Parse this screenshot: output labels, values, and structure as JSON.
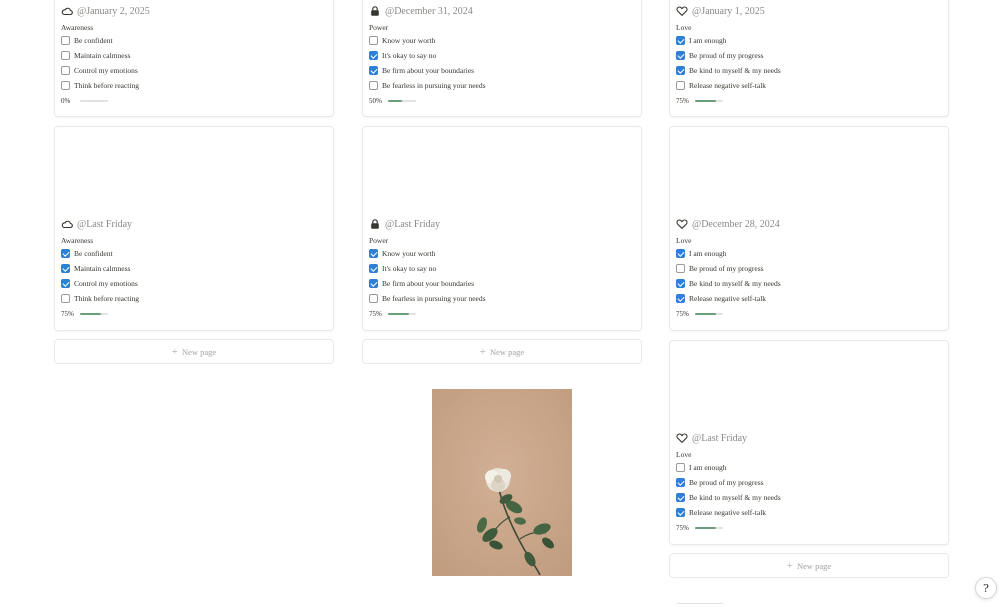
{
  "board": {
    "cards": [
      {
        "icon": "cloud-icon",
        "date": "@January 2, 2025",
        "category": "Awareness",
        "progress_label": "0%",
        "progress": 0.0,
        "tasks": [
          {
            "label": "Be confident",
            "checked": false
          },
          {
            "label": "Maintain calmness",
            "checked": false
          },
          {
            "label": "Control my emotions",
            "checked": false
          },
          {
            "label": "Think before reacting",
            "checked": false
          }
        ]
      },
      {
        "icon": "lock-icon",
        "date": "@December 31, 2024",
        "category": "Power",
        "progress_label": "50%",
        "progress": 0.5,
        "tasks": [
          {
            "label": "Know your worth",
            "checked": false
          },
          {
            "label": "It's okay to say no",
            "checked": true
          },
          {
            "label": "Be firm about your boundaries",
            "checked": true
          },
          {
            "label": "Be fearless in pursuing your needs",
            "checked": false
          }
        ]
      },
      {
        "icon": "heart-icon",
        "date": "@January 1, 2025",
        "category": "Love",
        "progress_label": "75%",
        "progress": 0.75,
        "tasks": [
          {
            "label": "I am enough",
            "checked": true
          },
          {
            "label": "Be proud of my progress",
            "checked": true
          },
          {
            "label": "Be kind to myself & my needs",
            "checked": true
          },
          {
            "label": "Release negative self-talk",
            "checked": false
          }
        ]
      },
      {
        "icon": "cloud-icon",
        "date": "@Last Friday",
        "category": "Awareness",
        "progress_label": "75%",
        "progress": 0.75,
        "tasks": [
          {
            "label": "Be confident",
            "checked": true
          },
          {
            "label": "Maintain calmness",
            "checked": true
          },
          {
            "label": "Control my emotions",
            "checked": true
          },
          {
            "label": "Think before reacting",
            "checked": false
          }
        ]
      },
      {
        "icon": "lock-icon",
        "date": "@Last Friday",
        "category": "Power",
        "progress_label": "75%",
        "progress": 0.75,
        "tasks": [
          {
            "label": "Know your worth",
            "checked": true
          },
          {
            "label": "It's okay to say no",
            "checked": true
          },
          {
            "label": "Be firm about your boundaries",
            "checked": true
          },
          {
            "label": "Be fearless in pursuing your needs",
            "checked": false
          }
        ]
      },
      {
        "icon": "heart-icon",
        "date": "@December 28, 2024",
        "category": "Love",
        "progress_label": "75%",
        "progress": 0.75,
        "tasks": [
          {
            "label": "I am enough",
            "checked": true
          },
          {
            "label": "Be proud of my progress",
            "checked": false
          },
          {
            "label": "Be kind to myself & my needs",
            "checked": true
          },
          {
            "label": "Release negative self-talk",
            "checked": true
          }
        ]
      },
      {
        "icon": "heart-icon",
        "date": "@Last Friday",
        "category": "Love",
        "progress_label": "75%",
        "progress": 0.75,
        "tasks": [
          {
            "label": "I am enough",
            "checked": false
          },
          {
            "label": "Be proud of my progress",
            "checked": true
          },
          {
            "label": "Be kind to myself & my needs",
            "checked": true
          },
          {
            "label": "Release negative self-talk",
            "checked": true
          }
        ]
      }
    ],
    "new_page_label": "New page",
    "photo_subject": "white-rose-image",
    "help_icon": "help-icon",
    "colors": {
      "check": "#2f7fd8",
      "progress": "#6b9e7b",
      "border": "#e9e9e7",
      "text": "#37352f",
      "muted": "#8a8986",
      "photo_bg": "#c9a589"
    }
  }
}
